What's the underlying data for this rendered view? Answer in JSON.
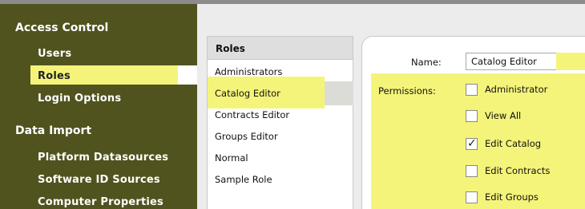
{
  "sidebar": {
    "sections": [
      {
        "title": "Access Control",
        "items": [
          {
            "label": "Users"
          },
          {
            "label": "Roles",
            "selected": true
          },
          {
            "label": "Login Options"
          }
        ]
      },
      {
        "title": "Data Import",
        "items": [
          {
            "label": "Platform Datasources"
          },
          {
            "label": "Software ID Sources"
          },
          {
            "label": "Computer Properties"
          }
        ]
      }
    ]
  },
  "roles_panel": {
    "header": "Roles",
    "items": [
      "Administrators",
      "Catalog Editor",
      "Contracts Editor",
      "Groups Editor",
      "Normal",
      "Sample Role"
    ],
    "selected": "Catalog Editor"
  },
  "details": {
    "name_label": "Name:",
    "name_value": "Catalog Editor",
    "permissions_label": "Permissions:",
    "permissions": [
      {
        "label": "Administrator",
        "checked": false
      },
      {
        "label": "View All",
        "checked": false
      },
      {
        "label": "Edit Catalog",
        "checked": true
      },
      {
        "label": "Edit Contracts",
        "checked": false
      },
      {
        "label": "Edit Groups",
        "checked": false
      }
    ]
  },
  "colors": {
    "sidebar_bg": "#51531f",
    "highlight": "#f5f47a",
    "panel_bg": "#ececec"
  }
}
